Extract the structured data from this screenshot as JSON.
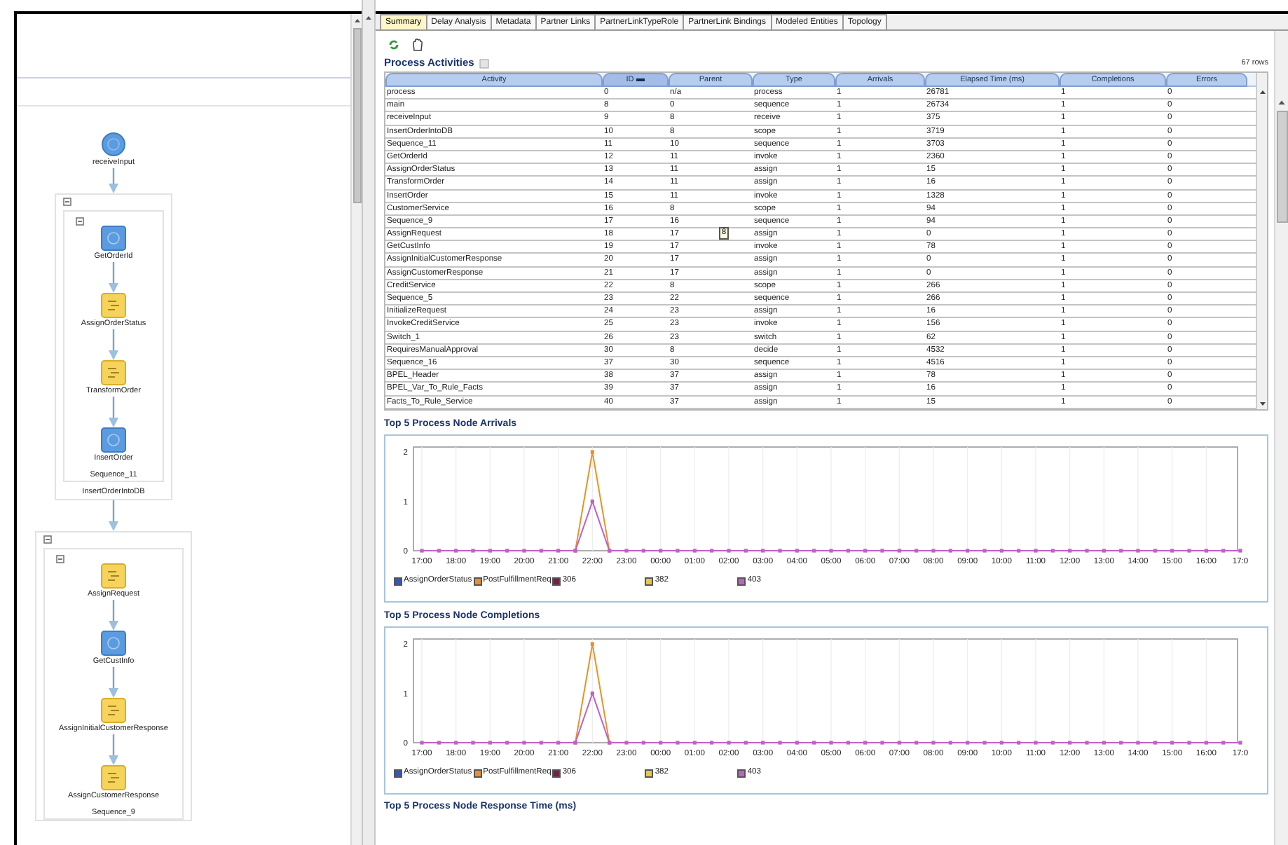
{
  "diagram": {
    "start": {
      "label": "receiveInput",
      "kind": "receive"
    },
    "scopes": [
      {
        "label": "InsertOrderIntoDB",
        "sequence_label": "Sequence_11",
        "nodes": [
          {
            "label": "GetOrderId",
            "kind": "invoke"
          },
          {
            "label": "AssignOrderStatus",
            "kind": "assign"
          },
          {
            "label": "TransformOrder",
            "kind": "assign"
          },
          {
            "label": "InsertOrder",
            "kind": "invoke"
          }
        ]
      },
      {
        "sequence_label": "Sequence_9",
        "nodes": [
          {
            "label": "AssignRequest",
            "kind": "assign"
          },
          {
            "label": "GetCustInfo",
            "kind": "invoke"
          },
          {
            "label": "AssignInitialCustomerResponse",
            "kind": "assign"
          },
          {
            "label": "AssignCustomerResponse",
            "kind": "assign"
          }
        ]
      }
    ]
  },
  "tabs": [
    {
      "label": "Summary",
      "selected": true
    },
    {
      "label": "Delay Analysis",
      "selected": false
    },
    {
      "label": "Metadata",
      "selected": false
    },
    {
      "label": "Partner Links",
      "selected": false
    },
    {
      "label": "PartnerLinkTypeRole",
      "selected": false
    },
    {
      "label": "PartnerLink Bindings",
      "selected": false
    },
    {
      "label": "Modeled Entities",
      "selected": false
    },
    {
      "label": "Topology",
      "selected": false
    }
  ],
  "activities": {
    "title": "Process Activities",
    "row_count": "67 rows",
    "columns": [
      {
        "label": "Activity",
        "sorted": false
      },
      {
        "label": "ID",
        "sorted": true
      },
      {
        "label": "Parent",
        "sorted": false
      },
      {
        "label": "Type",
        "sorted": false
      },
      {
        "label": "Arrivals",
        "sorted": false
      },
      {
        "label": "Elapsed Time (ms)",
        "sorted": false
      },
      {
        "label": "Completions",
        "sorted": false
      },
      {
        "label": "Errors",
        "sorted": false
      }
    ],
    "rows": [
      {
        "cells": [
          "process",
          "0",
          "n/a",
          "process",
          "1",
          "26781",
          "1",
          "0"
        ]
      },
      {
        "cells": [
          "main",
          "8",
          "0",
          "sequence",
          "1",
          "26734",
          "1",
          "0"
        ]
      },
      {
        "cells": [
          "receiveInput",
          "9",
          "8",
          "receive",
          "1",
          "375",
          "1",
          "0"
        ]
      },
      {
        "cells": [
          "InsertOrderIntoDB",
          "10",
          "8",
          "scope",
          "1",
          "3719",
          "1",
          "0"
        ]
      },
      {
        "cells": [
          "Sequence_11",
          "11",
          "10",
          "sequence",
          "1",
          "3703",
          "1",
          "0"
        ]
      },
      {
        "cells": [
          "GetOrderId",
          "12",
          "11",
          "invoke",
          "1",
          "2360",
          "1",
          "0"
        ]
      },
      {
        "cells": [
          "AssignOrderStatus",
          "13",
          "11",
          "assign",
          "1",
          "15",
          "1",
          "0"
        ]
      },
      {
        "cells": [
          "TransformOrder",
          "14",
          "11",
          "assign",
          "1",
          "16",
          "1",
          "0"
        ]
      },
      {
        "cells": [
          "InsertOrder",
          "15",
          "11",
          "invoke",
          "1",
          "1328",
          "1",
          "0"
        ]
      },
      {
        "cells": [
          "CustomerService",
          "16",
          "8",
          "scope",
          "1",
          "94",
          "1",
          "0"
        ]
      },
      {
        "cells": [
          "Sequence_9",
          "17",
          "16",
          "sequence",
          "1",
          "94",
          "1",
          "0"
        ]
      },
      {
        "cells": [
          "AssignRequest",
          "18",
          "17",
          "assign",
          "1",
          "0",
          "1",
          "0"
        ],
        "tooltip": "8"
      },
      {
        "cells": [
          "GetCustInfo",
          "19",
          "17",
          "invoke",
          "1",
          "78",
          "1",
          "0"
        ]
      },
      {
        "cells": [
          "AssignInitialCustomerResponse",
          "20",
          "17",
          "assign",
          "1",
          "0",
          "1",
          "0"
        ]
      },
      {
        "cells": [
          "AssignCustomerResponse",
          "21",
          "17",
          "assign",
          "1",
          "0",
          "1",
          "0"
        ]
      },
      {
        "cells": [
          "CreditService",
          "22",
          "8",
          "scope",
          "1",
          "266",
          "1",
          "0"
        ]
      },
      {
        "cells": [
          "Sequence_5",
          "23",
          "22",
          "sequence",
          "1",
          "266",
          "1",
          "0"
        ]
      },
      {
        "cells": [
          "InitializeRequest",
          "24",
          "23",
          "assign",
          "1",
          "16",
          "1",
          "0"
        ]
      },
      {
        "cells": [
          "InvokeCreditService",
          "25",
          "23",
          "invoke",
          "1",
          "156",
          "1",
          "0"
        ]
      },
      {
        "cells": [
          "Switch_1",
          "26",
          "23",
          "switch",
          "1",
          "62",
          "1",
          "0"
        ]
      },
      {
        "cells": [
          "RequiresManualApproval",
          "30",
          "8",
          "decide",
          "1",
          "4532",
          "1",
          "0"
        ]
      },
      {
        "cells": [
          "Sequence_16",
          "37",
          "30",
          "sequence",
          "1",
          "4516",
          "1",
          "0"
        ]
      },
      {
        "cells": [
          "BPEL_Header",
          "38",
          "37",
          "assign",
          "1",
          "78",
          "1",
          "0"
        ]
      },
      {
        "cells": [
          "BPEL_Var_To_Rule_Facts",
          "39",
          "37",
          "assign",
          "1",
          "16",
          "1",
          "0"
        ]
      },
      {
        "cells": [
          "Facts_To_Rule_Service",
          "40",
          "37",
          "assign",
          "1",
          "15",
          "1",
          "0"
        ]
      }
    ]
  },
  "charts": [
    {
      "title": "Top 5 Process Node Arrivals",
      "chart_data": {
        "type": "line",
        "grid": true,
        "categories": [
          "17:00",
          null,
          "18:00",
          null,
          "19:00",
          null,
          "20:00",
          null,
          "21:00",
          null,
          "22:00",
          null,
          "23:00",
          null,
          "00:00",
          null,
          "01:00",
          null,
          "02:00",
          null,
          "03:00",
          null,
          "04:00",
          null,
          "05:00",
          null,
          "06:00",
          null,
          "07:00",
          null,
          "08:00",
          null,
          "09:00",
          null,
          "10:00",
          null,
          "11:00",
          null,
          "12:00",
          null,
          "13:00",
          null,
          "14:00",
          null,
          "15:00",
          null,
          "16:00",
          null,
          "17:0"
        ],
        "yticks": [
          0,
          1,
          2
        ],
        "ylim": [
          0,
          2.1
        ],
        "series": [
          {
            "name": "AssignOrderStatus",
            "color": "#3355cc",
            "values": [
              null,
              null,
              null,
              null,
              null,
              null,
              null,
              null,
              null,
              null,
              null,
              null,
              null,
              null,
              null,
              null,
              null,
              null,
              null,
              null,
              null,
              null,
              null,
              null,
              null,
              null,
              null,
              null,
              null,
              null,
              null,
              null,
              null,
              null,
              null,
              null,
              null,
              null,
              null,
              null,
              null,
              null,
              null,
              null,
              null,
              null,
              null,
              null,
              null
            ]
          },
          {
            "name": "PostFulfillmentReq",
            "color": "#e8922a",
            "marker": "square",
            "values": [
              null,
              null,
              null,
              null,
              null,
              null,
              null,
              null,
              null,
              0,
              2,
              0,
              null,
              null,
              null,
              null,
              null,
              null,
              null,
              null,
              null,
              null,
              null,
              null,
              null,
              null,
              null,
              null,
              null,
              null,
              null,
              null,
              null,
              null,
              null,
              null,
              null,
              null,
              null,
              null,
              null,
              null,
              null,
              null,
              null,
              null,
              null,
              null,
              null
            ]
          },
          {
            "name": "306",
            "color": "#7a1f4a",
            "values": [
              null,
              null,
              null,
              null,
              null,
              null,
              null,
              null,
              null,
              null,
              null,
              null,
              null,
              null,
              null,
              null,
              null,
              null,
              null,
              null,
              null,
              null,
              null,
              null,
              null,
              null,
              null,
              null,
              null,
              null,
              null,
              null,
              null,
              null,
              null,
              null,
              null,
              null,
              null,
              null,
              null,
              null,
              null,
              null,
              null,
              null,
              null,
              null,
              null
            ]
          },
          {
            "name": "382",
            "color": "#e8c84a",
            "values": [
              null,
              null,
              null,
              null,
              null,
              null,
              null,
              null,
              null,
              null,
              null,
              null,
              null,
              null,
              null,
              null,
              null,
              null,
              null,
              null,
              null,
              null,
              null,
              null,
              null,
              null,
              null,
              null,
              null,
              null,
              null,
              null,
              null,
              null,
              null,
              null,
              null,
              null,
              null,
              null,
              null,
              null,
              null,
              null,
              null,
              null,
              null,
              null,
              null
            ]
          },
          {
            "name": "403",
            "color": "#c060c8",
            "marker": "square",
            "values": [
              0,
              0,
              0,
              0,
              0,
              0,
              0,
              0,
              0,
              0,
              1,
              0,
              0,
              0,
              0,
              0,
              0,
              0,
              0,
              0,
              0,
              0,
              0,
              0,
              0,
              0,
              0,
              0,
              0,
              0,
              0,
              0,
              0,
              0,
              0,
              0,
              0,
              0,
              0,
              0,
              0,
              0,
              0,
              0,
              0,
              0,
              0,
              0,
              0
            ]
          }
        ]
      }
    },
    {
      "title": "Top 5 Process Node Completions",
      "chart_data": {
        "type": "line",
        "grid": true,
        "categories": [
          "17:00",
          null,
          "18:00",
          null,
          "19:00",
          null,
          "20:00",
          null,
          "21:00",
          null,
          "22:00",
          null,
          "23:00",
          null,
          "00:00",
          null,
          "01:00",
          null,
          "02:00",
          null,
          "03:00",
          null,
          "04:00",
          null,
          "05:00",
          null,
          "06:00",
          null,
          "07:00",
          null,
          "08:00",
          null,
          "09:00",
          null,
          "10:00",
          null,
          "11:00",
          null,
          "12:00",
          null,
          "13:00",
          null,
          "14:00",
          null,
          "15:00",
          null,
          "16:00",
          null,
          "17:0"
        ],
        "yticks": [
          0,
          1,
          2
        ],
        "ylim": [
          0,
          2.1
        ],
        "series": [
          {
            "name": "AssignOrderStatus",
            "color": "#3355cc",
            "values": [
              null,
              null,
              null,
              null,
              null,
              null,
              null,
              null,
              null,
              null,
              null,
              null,
              null,
              null,
              null,
              null,
              null,
              null,
              null,
              null,
              null,
              null,
              null,
              null,
              null,
              null,
              null,
              null,
              null,
              null,
              null,
              null,
              null,
              null,
              null,
              null,
              null,
              null,
              null,
              null,
              null,
              null,
              null,
              null,
              null,
              null,
              null,
              null,
              null
            ]
          },
          {
            "name": "PostFulfillmentReq",
            "color": "#e8922a",
            "marker": "square",
            "values": [
              null,
              null,
              null,
              null,
              null,
              null,
              null,
              null,
              null,
              0,
              2,
              0,
              null,
              null,
              null,
              null,
              null,
              null,
              null,
              null,
              null,
              null,
              null,
              null,
              null,
              null,
              null,
              null,
              null,
              null,
              null,
              null,
              null,
              null,
              null,
              null,
              null,
              null,
              null,
              null,
              null,
              null,
              null,
              null,
              null,
              null,
              null,
              null,
              null
            ]
          },
          {
            "name": "306",
            "color": "#7a1f4a",
            "values": [
              null,
              null,
              null,
              null,
              null,
              null,
              null,
              null,
              null,
              null,
              null,
              null,
              null,
              null,
              null,
              null,
              null,
              null,
              null,
              null,
              null,
              null,
              null,
              null,
              null,
              null,
              null,
              null,
              null,
              null,
              null,
              null,
              null,
              null,
              null,
              null,
              null,
              null,
              null,
              null,
              null,
              null,
              null,
              null,
              null,
              null,
              null,
              null,
              null
            ]
          },
          {
            "name": "382",
            "color": "#e8c84a",
            "values": [
              null,
              null,
              null,
              null,
              null,
              null,
              null,
              null,
              null,
              null,
              null,
              null,
              null,
              null,
              null,
              null,
              null,
              null,
              null,
              null,
              null,
              null,
              null,
              null,
              null,
              null,
              null,
              null,
              null,
              null,
              null,
              null,
              null,
              null,
              null,
              null,
              null,
              null,
              null,
              null,
              null,
              null,
              null,
              null,
              null,
              null,
              null,
              null,
              null
            ]
          },
          {
            "name": "403",
            "color": "#c060c8",
            "marker": "square",
            "values": [
              0,
              0,
              0,
              0,
              0,
              0,
              0,
              0,
              0,
              0,
              1,
              0,
              0,
              0,
              0,
              0,
              0,
              0,
              0,
              0,
              0,
              0,
              0,
              0,
              0,
              0,
              0,
              0,
              0,
              0,
              0,
              0,
              0,
              0,
              0,
              0,
              0,
              0,
              0,
              0,
              0,
              0,
              0,
              0,
              0,
              0,
              0,
              0,
              0
            ]
          }
        ]
      }
    }
  ],
  "next_section": {
    "title": "Top 5 Process Node Response Time (ms)"
  }
}
